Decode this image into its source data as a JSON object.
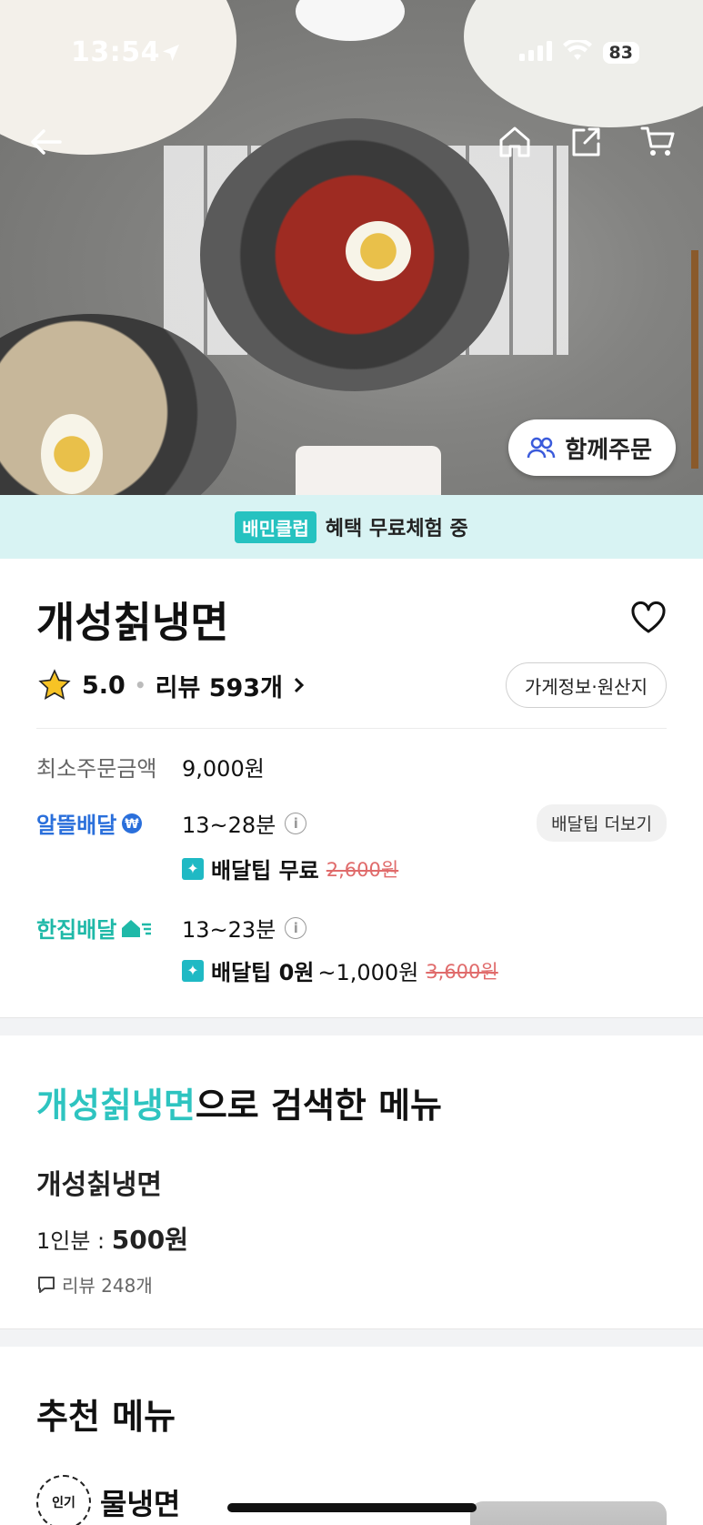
{
  "status_bar": {
    "time": "13:54",
    "battery": "83"
  },
  "hero": {
    "group_order_label": "함께주문"
  },
  "club_bar": {
    "badge": "배민클럽",
    "text": "혜택 무료체험 중"
  },
  "store": {
    "name": "개성칡냉면",
    "rating": "5.0",
    "review_label": "리뷰 593개",
    "info_button": "가게정보·원산지",
    "min_order_label": "최소주문금액",
    "min_order_value": "9,000원"
  },
  "delivery": {
    "saver": {
      "label": "알뜰배달",
      "time": "13~28분",
      "tip_more": "배달팁 더보기",
      "tip_label": "배달팁 무료",
      "tip_original": "2,600원"
    },
    "single": {
      "label": "한집배달",
      "time": "13~23분",
      "tip_label": "배달팁 0원",
      "tip_range": "~1,000원",
      "tip_original": "3,600원"
    }
  },
  "search_section": {
    "keyword": "개성칡냉면",
    "suffix": "으로 검색한 메뉴",
    "menu_name": "개성칡냉면",
    "price_prefix": "1인분 : ",
    "price_value": "500원",
    "review_count": "리뷰 248개"
  },
  "recommend": {
    "title": "추천 메뉴",
    "badge": "인기",
    "item_name": "물냉면"
  },
  "colors": {
    "accent": "#2ec4c0",
    "club_bg": "#d8f3f3",
    "saver_blue": "#2a6fdb",
    "single_teal": "#1fb9a8",
    "strike_red": "#e06b6b"
  }
}
